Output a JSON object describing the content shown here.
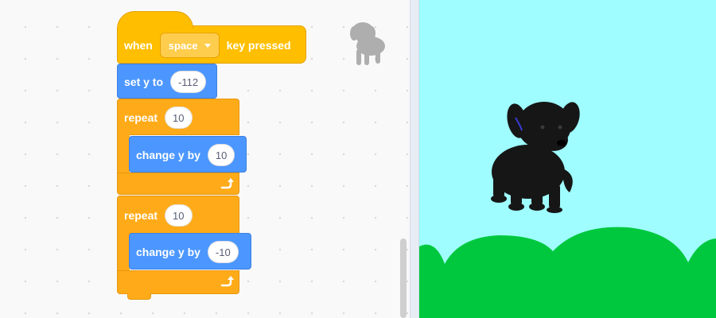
{
  "script": {
    "hat": {
      "when": "when",
      "key": "space",
      "suffix": "key pressed"
    },
    "set_y": {
      "label": "set y to",
      "value": "-112"
    },
    "loop1": {
      "label": "repeat",
      "count": "10",
      "inner": {
        "label": "change y by",
        "value": "10"
      }
    },
    "loop2": {
      "label": "repeat",
      "count": "10",
      "inner": {
        "label": "change y by",
        "value": "-10"
      }
    }
  },
  "sprite": {
    "thumbnail_icon": "puppy-icon"
  },
  "stage": {
    "sprite_icon": "puppy-icon",
    "backdrop": "hills"
  },
  "colors": {
    "event": "#ffbf00",
    "control": "#ffab19",
    "motion": "#4c97ff",
    "stage_sky": "#9ffcff",
    "stage_hills": "#00c83e"
  }
}
